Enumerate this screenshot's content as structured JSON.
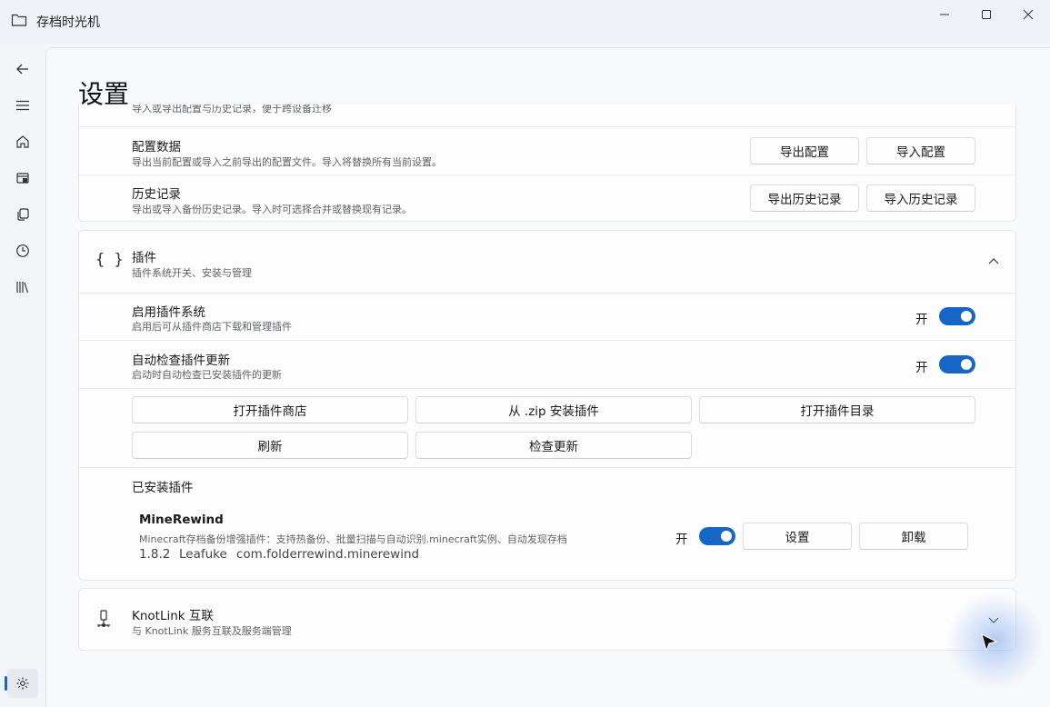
{
  "window": {
    "title": "存档时光机",
    "controls": [
      "minimize",
      "maximize",
      "close"
    ]
  },
  "nav": {
    "items": [
      {
        "name": "back-icon"
      },
      {
        "name": "menu-icon"
      },
      {
        "name": "home-icon"
      },
      {
        "name": "archive-icon"
      },
      {
        "name": "copy-icon"
      },
      {
        "name": "clock-icon"
      },
      {
        "name": "library-icon"
      }
    ],
    "settings": {
      "name": "settings-icon",
      "selected": true
    }
  },
  "page": {
    "title": "设置"
  },
  "data_section": {
    "cutoff_desc": "导入或导出配置与历史记录，便于跨设备迁移",
    "rows": [
      {
        "title": "配置数据",
        "desc": "导出当前配置或导入之前导出的配置文件。导入将替换所有当前设置。",
        "buttons": [
          "导出配置",
          "导入配置"
        ]
      },
      {
        "title": "历史记录",
        "desc": "导出或导入备份历史记录。导入时可选择合并或替换现有记录。",
        "buttons": [
          "导出历史记录",
          "导入历史记录"
        ]
      }
    ]
  },
  "plugins": {
    "icon": "{ }",
    "title": "插件",
    "desc": "插件系统开关、安装与管理",
    "enable": {
      "title": "启用插件系统",
      "desc": "启用后可从插件商店下载和管理插件",
      "state": "开",
      "on": true
    },
    "auto_update": {
      "title": "自动检查插件更新",
      "desc": "启动时自动检查已安装插件的更新",
      "state": "开",
      "on": true
    },
    "actions": [
      "打开插件商店",
      "从 .zip 安装插件",
      "打开插件目录",
      "刷新",
      "检查更新"
    ],
    "installed_header": "已安装插件",
    "installed": [
      {
        "name": "MineRewind",
        "desc": "Minecraft存档备份增强插件：支持热备份、批量扫描与自动识别.minecraft实例、自动发现存档",
        "version": "1.8.2",
        "author": "Leafuke",
        "id": "com.folderrewind.minerewind",
        "state": "开",
        "on": true,
        "buttons": [
          "设置",
          "卸载"
        ]
      }
    ]
  },
  "knotlink": {
    "title": "KnotLink 互联",
    "desc": "与 KnotLink 服务互联及服务端管理"
  },
  "colors": {
    "accent": "#1566c6",
    "background": "#f3f5f8",
    "card": "#fdfdfd"
  }
}
